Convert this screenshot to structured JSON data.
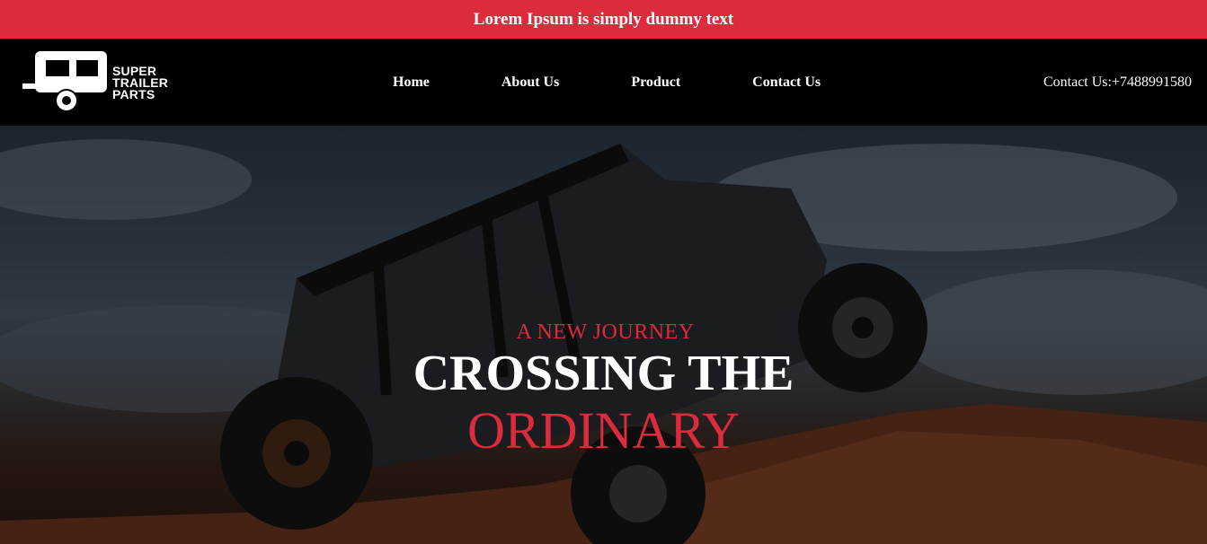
{
  "announcement": {
    "text": "Lorem Ipsum is simply dummy text"
  },
  "brand": {
    "lines": [
      "SUPER",
      "TRAILER",
      "PARTS"
    ]
  },
  "nav": {
    "items": [
      {
        "label": "Home"
      },
      {
        "label": "About Us"
      },
      {
        "label": "Product"
      },
      {
        "label": "Contact Us"
      }
    ],
    "contact": "Contact Us:+7488991580"
  },
  "hero": {
    "kicker": "A NEW JOURNEY",
    "headline": "CROSSING THE",
    "headline_accent": "ORDINARY"
  },
  "colors": {
    "accent": "#dc2b3c",
    "nav_bg": "#000000",
    "text": "#ffffff"
  }
}
